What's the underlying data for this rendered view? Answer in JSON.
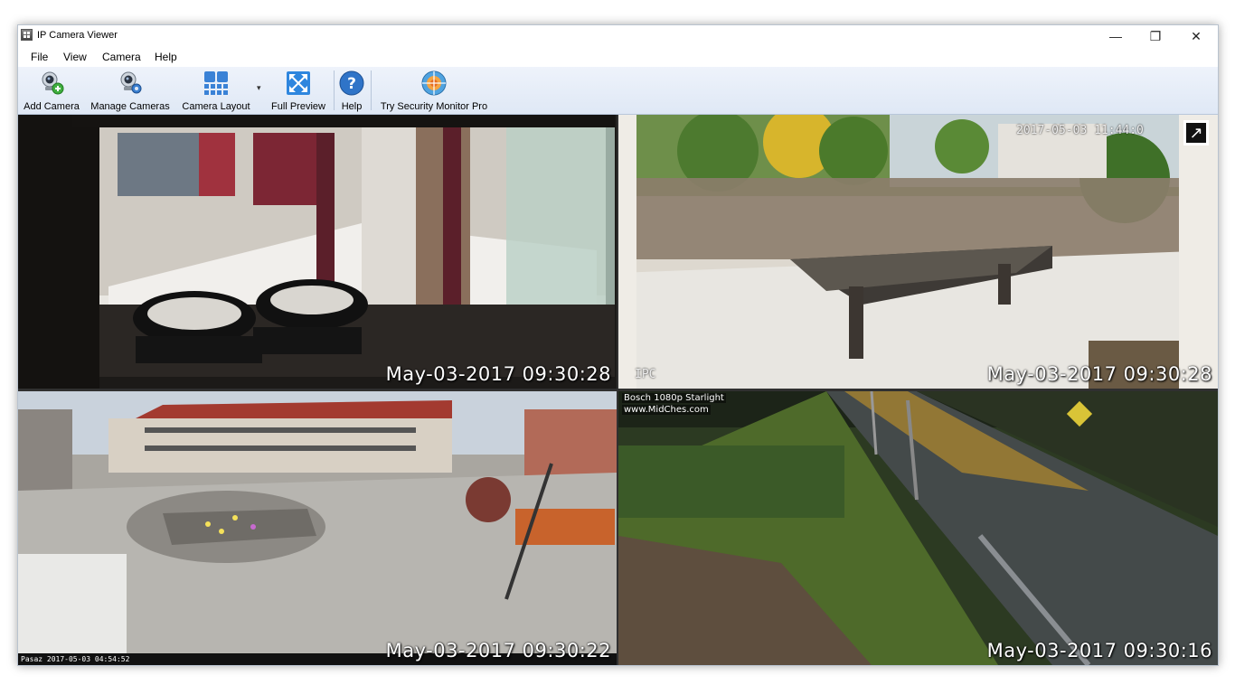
{
  "window": {
    "title": "IP Camera Viewer",
    "controls": {
      "minimize": "—",
      "restore": "❐",
      "close": "✕"
    }
  },
  "menu": [
    "File",
    "View",
    "Camera",
    "Help"
  ],
  "toolbar": {
    "add_camera": "Add Camera",
    "manage_cameras": "Manage Cameras",
    "camera_layout": "Camera Layout",
    "full_preview": "Full Preview",
    "help": "Help",
    "try_pro": "Try Security Monitor Pro",
    "dropdown_arrow": "▾"
  },
  "cameras": [
    {
      "timestamp": "May-03-2017 09:30:28"
    },
    {
      "timestamp": "May-03-2017 09:30:28",
      "osd_time": "2017-05-03 11:44:0",
      "osd_label": "IPC",
      "expand_icon": "↗"
    },
    {
      "timestamp": "May-03-2017 09:30:22",
      "osd_footer": "Pasaz 2017-05-03 04:54:52"
    },
    {
      "timestamp": "May-03-2017 09:30:16",
      "osd_line1": "Bosch 1080p Starlight",
      "osd_line2": "www.MidChes.com"
    }
  ],
  "colors": {
    "selected_border": "#e8b84a",
    "toolbar_bg": "#e4ecf7"
  }
}
